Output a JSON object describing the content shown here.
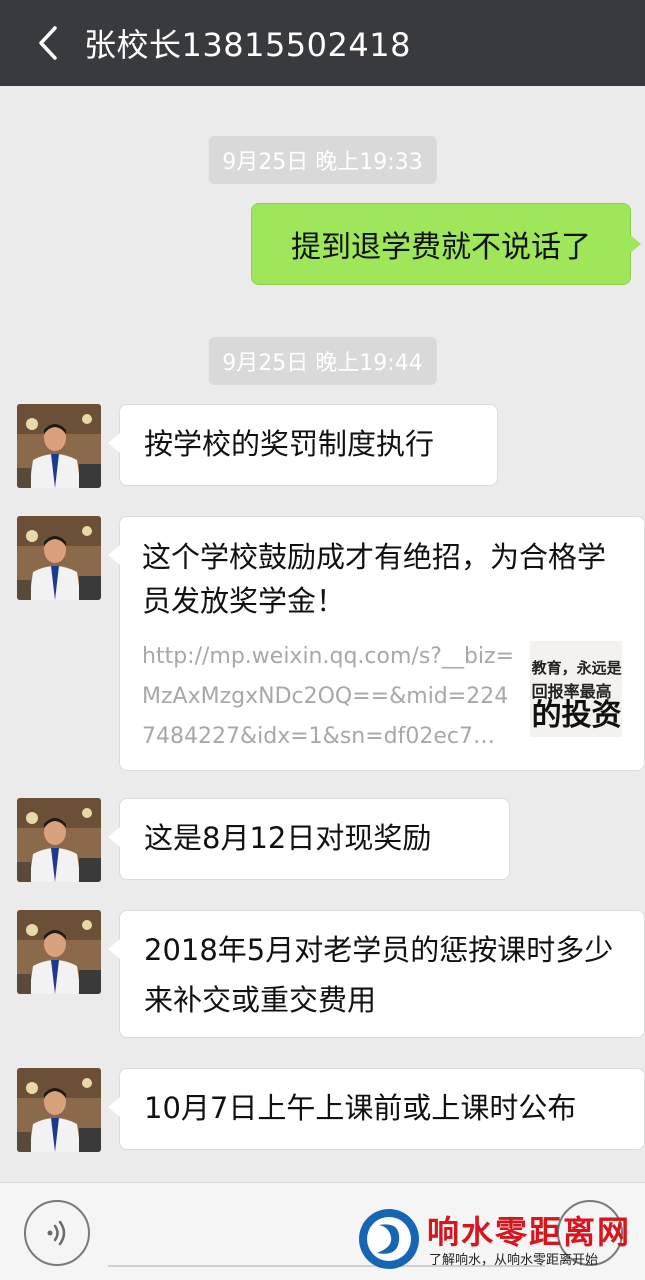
{
  "header": {
    "title": "张校长13815502418"
  },
  "timestamps": [
    "9月25日 晚上19:33",
    "9月25日 晚上19:44"
  ],
  "outgoing": {
    "text": "提到退学费就不说话了"
  },
  "incoming": [
    {
      "text": "按学校的奖罚制度执行"
    },
    {
      "title": "这个学校鼓励成才有绝招，为合格学员发放奖学金！",
      "url": "http://mp.weixin.qq.com/s?__biz=MzAxMzgxNDc2OQ==&mid=2247484227&idx=1&sn=df02ec7…",
      "thumb_lines": [
        "教育，永远是",
        "回报率最高",
        "的投资"
      ]
    },
    {
      "text": "这是8月12日对现奖励"
    },
    {
      "text": "2018年5月对老学员的惩按课时多少来补交或重交费用"
    },
    {
      "text": "10月7日上午上课前或上课时公布"
    }
  ],
  "watermark": {
    "title": "响水零距离网",
    "subtitle": "了解响水，从响水零距离开始"
  },
  "colors": {
    "titlebar": "#393a3f",
    "outgoing_bubble": "#9fe65a",
    "background": "#ebebeb",
    "watermark_red": "#d8141c"
  }
}
